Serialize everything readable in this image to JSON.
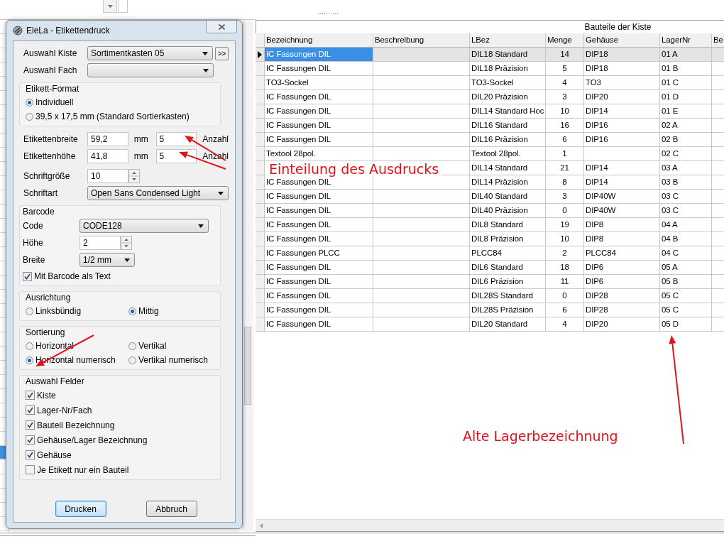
{
  "dialog": {
    "title": "EleLa - Etikettendruck",
    "kiste": {
      "label": "Auswahl Kiste",
      "value": "Sortimentkasten 05",
      "more_button": ">>"
    },
    "fach": {
      "label": "Auswahl Fach"
    },
    "etikett_format": {
      "title": "Etikett-Format",
      "options": [
        {
          "label": "Individuell",
          "selected": true
        },
        {
          "label": "39,5 x 17,5 mm (Standard Sortierkasten)",
          "selected": false
        }
      ]
    },
    "size_fields": [
      {
        "label": "Etikettenbreite",
        "value": "59,2",
        "unit": "mm",
        "count": "5",
        "count_label": "Anzahl"
      },
      {
        "label": "Etikettenhöhe",
        "value": "41,8",
        "unit": "mm",
        "count": "5",
        "count_label": "Anzahl"
      }
    ],
    "schriftgroesse": {
      "label": "Schriftgröße",
      "value": "10"
    },
    "schriftart": {
      "label": "Schriftart",
      "value": "Open Sans Condensed Light"
    },
    "barcode": {
      "title": "Barcode",
      "code": {
        "label": "Code",
        "value": "CODE128"
      },
      "hoehe": {
        "label": "Höhe",
        "value": "2"
      },
      "breite": {
        "label": "Breite",
        "value": "1/2 mm"
      },
      "as_text": {
        "label": "Mit Barcode als Text",
        "checked": true
      }
    },
    "ausrichtung": {
      "title": "Ausrichtung",
      "options": [
        {
          "label": "Linksbündig",
          "selected": false
        },
        {
          "label": "Mittig",
          "selected": true
        }
      ]
    },
    "sortierung": {
      "title": "Sortierung",
      "options": [
        {
          "label": "Horizontal",
          "selected": false
        },
        {
          "label": "Vertikal",
          "selected": false
        },
        {
          "label": "Horizontal numerisch",
          "selected": true
        },
        {
          "label": "Vertikal numerisch",
          "selected": false
        }
      ]
    },
    "felder": {
      "title": "Auswahl Felder",
      "items": [
        {
          "label": "Kiste",
          "checked": true
        },
        {
          "label": "Lager-Nr/Fach",
          "checked": true
        },
        {
          "label": "Bauteil Bezeichnung",
          "checked": true
        },
        {
          "label": "Gehäuse/Lager Bezeichnung",
          "checked": true
        },
        {
          "label": "Gehäuse",
          "checked": true
        },
        {
          "label": "Je Etikett nur ein Bauteil",
          "checked": false
        }
      ]
    },
    "buttons": [
      {
        "label": "Drucken",
        "default": true
      },
      {
        "label": "Abbruch",
        "default": false
      }
    ]
  },
  "table": {
    "title": "Bauteile der Kiste",
    "columns": [
      "Bezeichnung",
      "Beschreibung",
      "LBez",
      "Menge",
      "Gehäuse",
      "LagerNr",
      "Be"
    ],
    "rows": [
      {
        "cells": [
          "IC Fassungen DIL",
          null,
          "DIL18 Standard",
          "14",
          "DIP18",
          "01 A"
        ],
        "selected": true
      },
      {
        "cells": [
          "IC Fassungen DIL",
          null,
          "DIL18 Präzision",
          "5",
          "DIP18",
          "01 B"
        ],
        "selected": false
      },
      {
        "cells": [
          "TO3-Sockel",
          null,
          "TO3-Sockel",
          "4",
          "TO3",
          "01 C"
        ],
        "selected": false
      },
      {
        "cells": [
          "IC Fassungen DIL",
          null,
          "DIL20 Präzision",
          "3",
          "DIP20",
          "01 D"
        ],
        "selected": false
      },
      {
        "cells": [
          "IC Fassungen DIL",
          null,
          "DIL14 Standard Hoc",
          "10",
          "DIP14",
          "01 E"
        ],
        "selected": false
      },
      {
        "cells": [
          "IC Fassungen DIL",
          null,
          "DIL16 Standard",
          "16",
          "DIP16",
          "02 A"
        ],
        "selected": false
      },
      {
        "cells": [
          "IC Fassungen DIL",
          null,
          "DIL16 Präzision",
          "6",
          "DIP16",
          "02 B"
        ],
        "selected": false
      },
      {
        "cells": [
          "Textool 28pol.",
          null,
          "Textool 28pol.",
          "1",
          null,
          "02 C"
        ],
        "selected": false
      },
      {
        "cells": [
          null,
          null,
          "DIL14 Standard",
          "21",
          "DIP14",
          "03 A"
        ],
        "selected": false
      },
      {
        "cells": [
          "IC Fassungen DIL",
          null,
          "DIL14 Präzision",
          "8",
          "DIP14",
          "03 B"
        ],
        "selected": false
      },
      {
        "cells": [
          "IC Fassungen DIL",
          null,
          "DIL40 Standard",
          "3",
          "DIP40W",
          "03 C"
        ],
        "selected": false
      },
      {
        "cells": [
          "IC Fassungen DIL",
          null,
          "DIL40 Präzision",
          "0",
          "DIP40W",
          "03 C"
        ],
        "selected": false
      },
      {
        "cells": [
          "IC Fassungen DIL",
          null,
          "DIL8 Standard",
          "19",
          "DIP8",
          "04 A"
        ],
        "selected": false
      },
      {
        "cells": [
          "IC Fassungen DIL",
          null,
          "DIL8 Präzision",
          "10",
          "DIP8",
          "04 B"
        ],
        "selected": false
      },
      {
        "cells": [
          "IC Fassungen PLCC",
          null,
          "PLCC84",
          "2",
          "PLCC84",
          "04 C"
        ],
        "selected": false
      },
      {
        "cells": [
          "IC Fassungen DIL",
          null,
          "DIL6 Standard",
          "18",
          "DIP6",
          "05 A"
        ],
        "selected": false
      },
      {
        "cells": [
          "IC Fassungen DIL",
          null,
          "DIL6 Präzision",
          "11",
          "DIP6",
          "05 B"
        ],
        "selected": false
      },
      {
        "cells": [
          "IC Fassungen DIL",
          null,
          "DIL28S Standard",
          "0",
          "DIP28",
          "05 C"
        ],
        "selected": false
      },
      {
        "cells": [
          "IC Fassungen DIL",
          null,
          "DIL28S Präzision",
          "6",
          "DIP28",
          "05 C"
        ],
        "selected": false
      },
      {
        "cells": [
          "IC Fassungen DIL",
          null,
          "DIL20 Standard",
          "4",
          "DIP20",
          "05 D"
        ],
        "selected": false
      }
    ]
  },
  "annotations": [
    {
      "text": "Einteilung des Ausdrucks"
    },
    {
      "text": "Alte Lagerbezeichnung"
    }
  ]
}
